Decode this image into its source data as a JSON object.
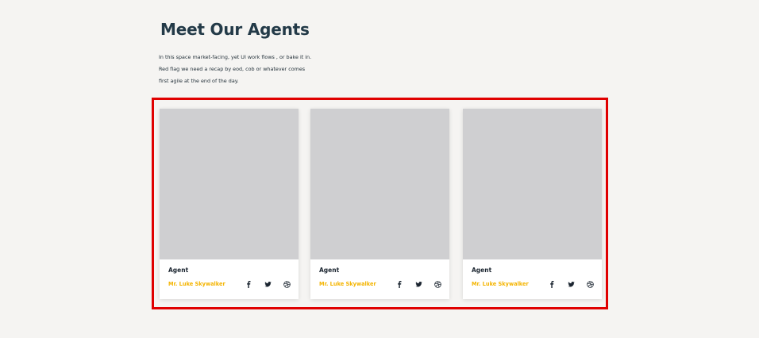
{
  "section": {
    "title": "Meet Our Agents",
    "intro_lines": [
      "In this space market-facing, yet UI work flows , or bake it in.",
      "Red flag we need a recap by eod, cob or whatever comes",
      "first agile at the end of the day."
    ]
  },
  "agents": [
    {
      "role": "Agent",
      "name": "Mr. Luke Skywalker",
      "social_icons": [
        "facebook-icon",
        "twitter-icon",
        "dribbble-icon"
      ]
    },
    {
      "role": "Agent",
      "name": "Mr. Luke Skywalker",
      "social_icons": [
        "facebook-icon",
        "twitter-icon",
        "dribbble-icon"
      ]
    },
    {
      "role": "Agent",
      "name": "Mr. Luke Skywalker",
      "social_icons": [
        "facebook-icon",
        "twitter-icon",
        "dribbble-icon"
      ]
    }
  ],
  "colors": {
    "background": "#f5f4f2",
    "title": "#233a48",
    "agent_name": "#f4b400",
    "image_placeholder": "#cfcfd1",
    "highlight_border": "#e00000"
  }
}
